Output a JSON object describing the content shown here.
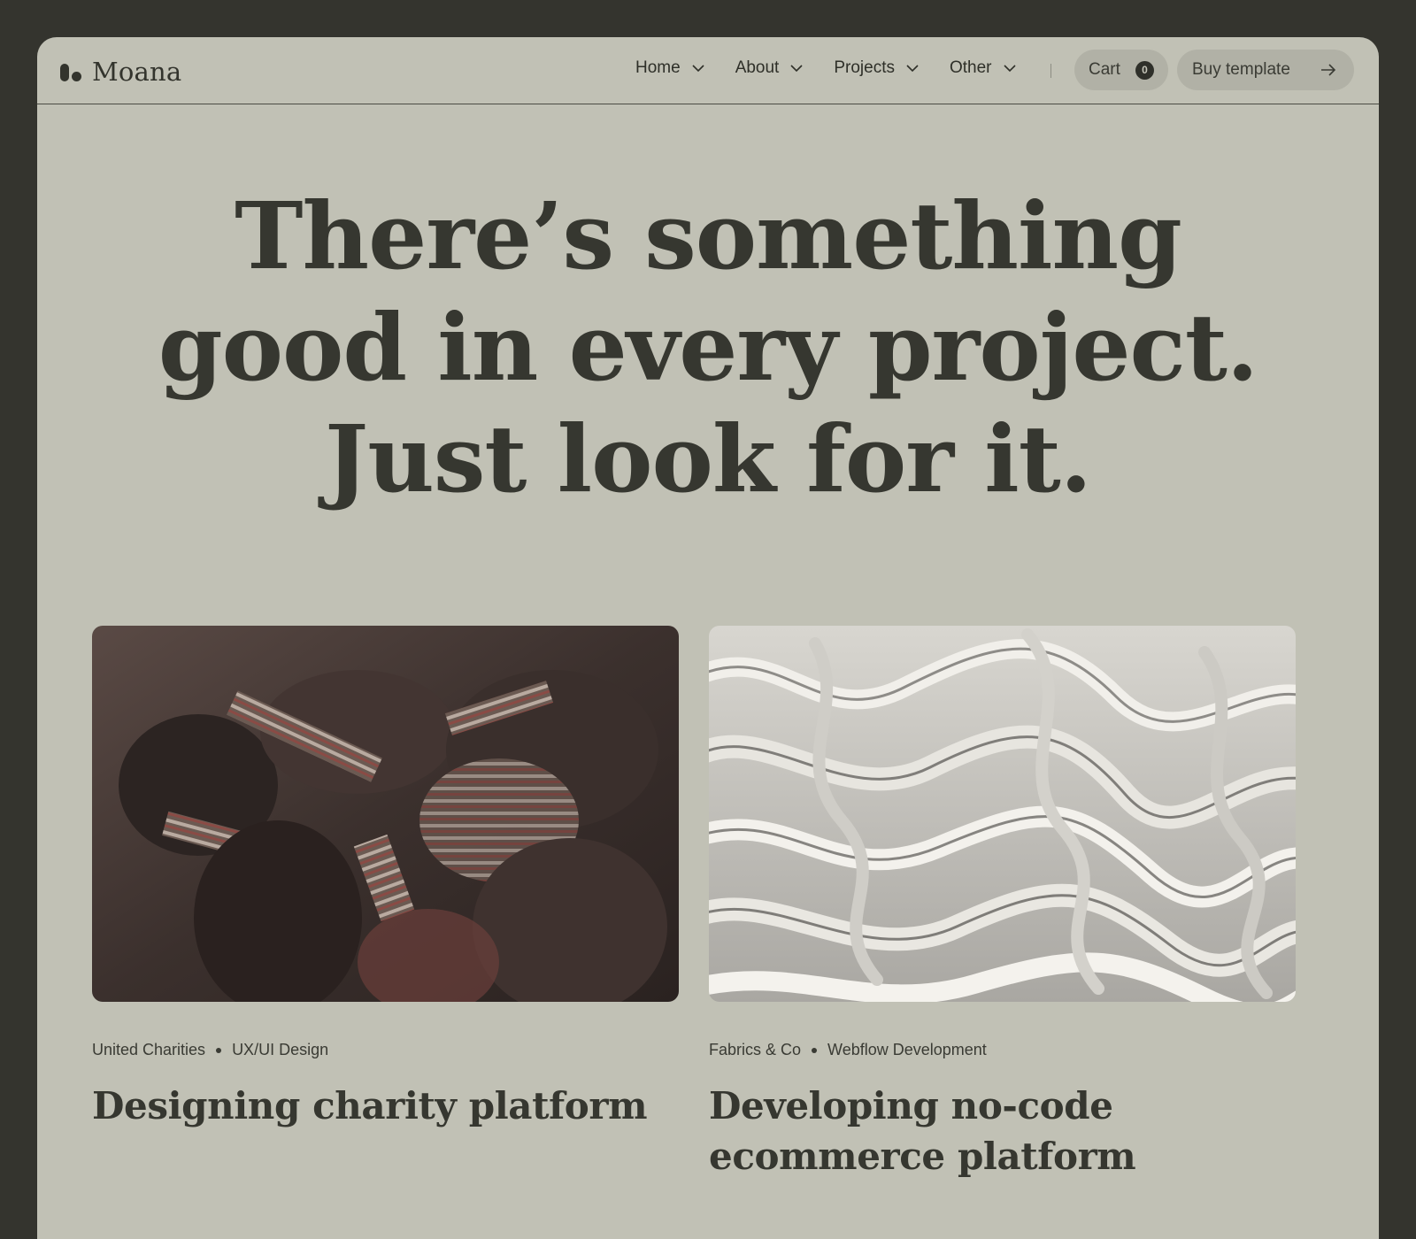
{
  "brand": {
    "name": "Moana",
    "logo_icon": "moana-logo-icon"
  },
  "nav": {
    "items": [
      {
        "label": "Home",
        "icon": "chevron-down-icon"
      },
      {
        "label": "About",
        "icon": "chevron-down-icon"
      },
      {
        "label": "Projects",
        "icon": "chevron-down-icon"
      },
      {
        "label": "Other",
        "icon": "chevron-down-icon"
      }
    ],
    "cart": {
      "label": "Cart",
      "count": "0"
    },
    "buy": {
      "label": "Buy template",
      "icon": "arrow-right-icon"
    }
  },
  "hero": {
    "lines": [
      "There’s something",
      "good in every project.",
      "Just look for it."
    ]
  },
  "projects": [
    {
      "client": "United Charities",
      "category": "UX/UI Design",
      "title": "Designing charity platform",
      "image": "crowd-photo"
    },
    {
      "client": "Fabrics & Co",
      "category": "Webflow Development",
      "title": "Developing no-code ecommerce platform",
      "image": "fabric-waves-render"
    }
  ],
  "colors": {
    "background": "#34342e",
    "surface": "#c1c1b5",
    "button": "#b1b1a6",
    "text": "#33342d"
  }
}
